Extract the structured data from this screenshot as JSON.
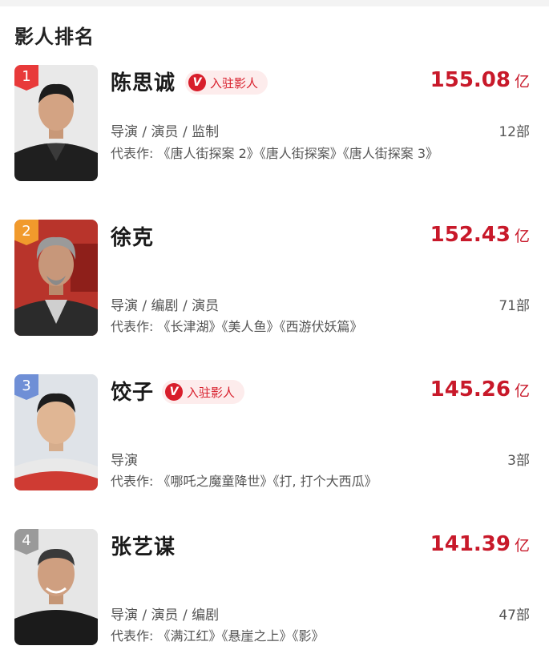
{
  "section_title": "影人排名",
  "people": [
    {
      "rank": "1",
      "name": "陈思诚",
      "verified_label": "入驻影人",
      "box_value": "155.08",
      "box_unit": "亿",
      "roles": "导演 / 演员 / 监制",
      "count": "12部",
      "works": "代表作: 《唐人街探案 2》《唐人街探案》《唐人街探案 3》",
      "badge_color": "#e83a3a"
    },
    {
      "rank": "2",
      "name": "徐克",
      "verified_label": "",
      "box_value": "152.43",
      "box_unit": "亿",
      "roles": "导演 / 编剧 / 演员",
      "count": "71部",
      "works": "代表作: 《长津湖》《美人鱼》《西游伏妖篇》",
      "badge_color": "#f19a2c"
    },
    {
      "rank": "3",
      "name": "饺子",
      "verified_label": "入驻影人",
      "box_value": "145.26",
      "box_unit": "亿",
      "roles": "导演",
      "count": "3部",
      "works": "代表作: 《哪吒之魔童降世》《打, 打个大西瓜》",
      "badge_color": "#6f8fd6"
    },
    {
      "rank": "4",
      "name": "张艺谋",
      "verified_label": "",
      "box_value": "141.39",
      "box_unit": "亿",
      "roles": "导演 / 演员 / 编剧",
      "count": "47部",
      "works": "代表作: 《满江红》《悬崖之上》《影》",
      "badge_color": "#9a9a9a"
    }
  ],
  "icons": {
    "verified": "verified-v-icon",
    "verified_glyph": "V"
  }
}
